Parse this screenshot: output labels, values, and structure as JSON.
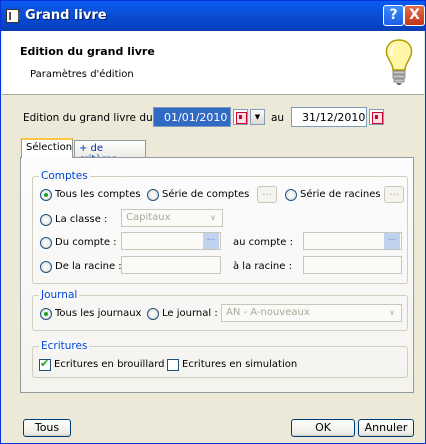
{
  "window": {
    "title": "Grand livre",
    "help_btn": "?",
    "close_btn": "X"
  },
  "header": {
    "title": "Edition du grand livre",
    "subtitle": "Paramètres d'édition"
  },
  "dates": {
    "label": "Edition du grand livre du :",
    "from": "01/01/2010",
    "au_label": "au",
    "to": "31/12/2010"
  },
  "tabs": [
    {
      "label": "Sélection"
    },
    {
      "label": "+ de critères"
    }
  ],
  "comptes": {
    "legend": "Comptes",
    "tous": "Tous les comptes",
    "serie_comptes": "Série de comptes",
    "serie_racines": "Série de racines",
    "classe_label": "La classe :",
    "classe_value": "Capitaux",
    "du_compte": "Du compte :",
    "au_compte": "au compte :",
    "de_racine": "De la racine :",
    "a_racine": "à la racine :",
    "dots": "..."
  },
  "journal": {
    "legend": "Journal",
    "tous": "Tous les journaux",
    "le_journal": "Le journal :",
    "journal_value": "AN - A-nouveaux"
  },
  "ecritures": {
    "legend": "Ecritures",
    "brouillard": "Ecritures en brouillard",
    "simulation": "Ecritures en simulation"
  },
  "footer": {
    "tous": "Tous",
    "ok": "OK",
    "annuler": "Annuler"
  }
}
